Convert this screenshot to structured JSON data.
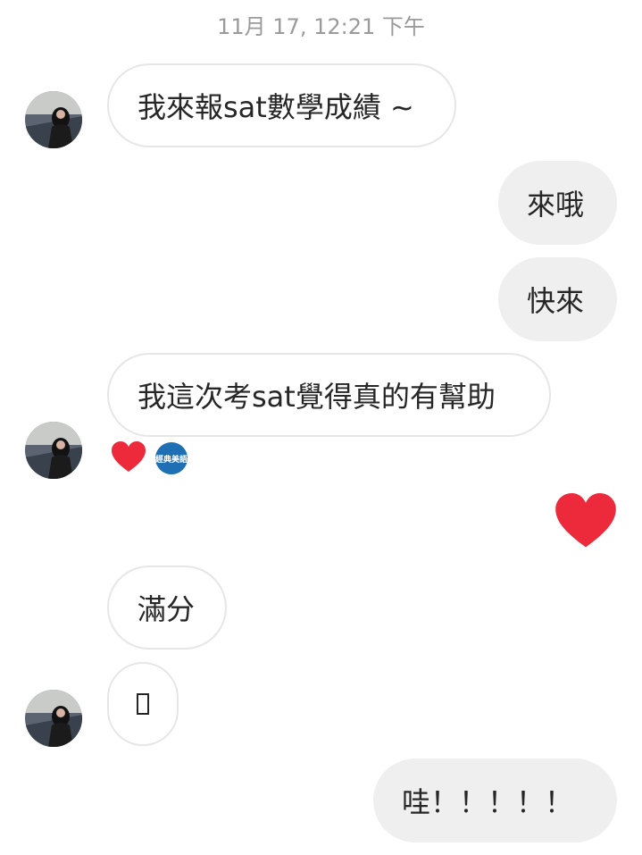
{
  "timestamp": "11月 17, 12:21 下午",
  "messages": {
    "m1": "我來報sat數學成績 ~",
    "m2": "來哦",
    "m3": "快來",
    "m4": "我這次考sat覺得真的有幫助",
    "m5": "滿分",
    "m6": "",
    "m7": "哇！！！！！"
  },
  "reactions": {
    "badge_text": "經典美語"
  },
  "colors": {
    "heart": "#ed2a3c",
    "incoming_border": "#e6e6e6",
    "outgoing_bg": "#efefef",
    "badge": "#1f6fb5"
  },
  "icons": [
    "avatar-image",
    "heart-icon",
    "brand-badge-icon",
    "heart-sticker-icon",
    "missing-glyph-icon"
  ]
}
